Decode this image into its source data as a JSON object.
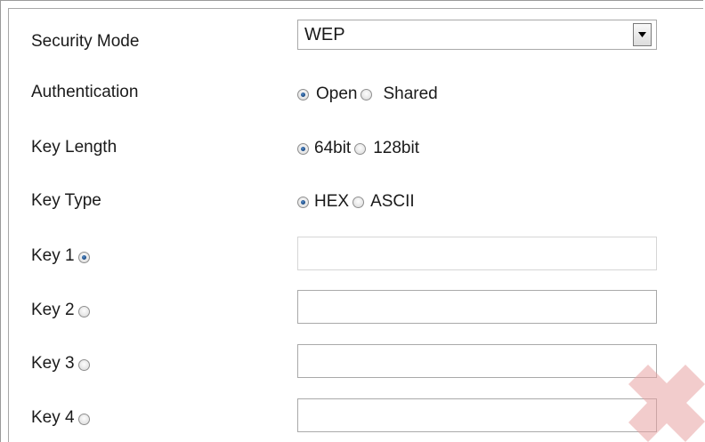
{
  "security_mode": {
    "label": "Security Mode",
    "value": "WEP"
  },
  "authentication": {
    "label": "Authentication",
    "options": [
      {
        "label": "Open",
        "checked": true
      },
      {
        "label": "Shared",
        "checked": false
      }
    ]
  },
  "key_length": {
    "label": "Key Length",
    "options": [
      {
        "label": "64bit",
        "checked": true
      },
      {
        "label": "128bit",
        "checked": false
      }
    ]
  },
  "key_type": {
    "label": "Key Type",
    "options": [
      {
        "label": "HEX",
        "checked": true
      },
      {
        "label": "ASCII",
        "checked": false
      }
    ]
  },
  "keys": [
    {
      "label": "Key 1",
      "selected": true,
      "value": ""
    },
    {
      "label": "Key 2",
      "selected": false,
      "value": ""
    },
    {
      "label": "Key 3",
      "selected": false,
      "value": ""
    },
    {
      "label": "Key 4",
      "selected": false,
      "value": ""
    }
  ],
  "colors": {
    "accent_radio": "#1e4f8a",
    "watermark": "#e8a3a3"
  }
}
